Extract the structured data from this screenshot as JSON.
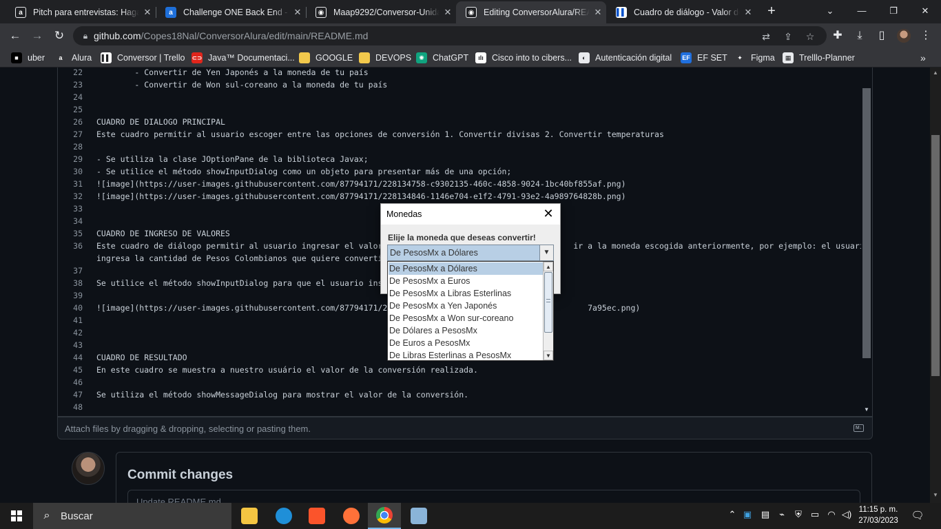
{
  "browser": {
    "tabs": [
      {
        "title": "Pitch para entrevistas: Haga p",
        "favicon": "alura-icon",
        "color": "#202124",
        "letter": "a"
      },
      {
        "title": "Challenge ONE Back End - Ja",
        "favicon": "alura-blue-icon",
        "color": "#1e6fd9",
        "letter": "a"
      },
      {
        "title": "Maap9292/Conversor-Unidad",
        "favicon": "github-icon",
        "color": "#202124",
        "letter": "◉"
      },
      {
        "title": "Editing ConversorAlura/READ",
        "favicon": "github-icon",
        "color": "#202124",
        "letter": "◉"
      },
      {
        "title": "Cuadro de diálogo - Valor de",
        "favicon": "trello-icon",
        "color": "#ffffff",
        "letter": "▌▌"
      }
    ],
    "url_domain": "github.com",
    "url_path": "/Copes18Nal/ConversorAlura/edit/main/README.md",
    "bookmarks": [
      {
        "label": "uber",
        "icon": "uber-icon",
        "color": "#000000",
        "glyph": "■"
      },
      {
        "label": "Alura",
        "icon": "alura-icon",
        "color": "#35363a",
        "glyph": "a"
      },
      {
        "label": "Conversor | Trello",
        "icon": "trello-icon",
        "color": "#ffffff",
        "glyph": "▌▌"
      },
      {
        "label": "Java™ Documentaci...",
        "icon": "oracle-icon",
        "color": "#e0251b",
        "glyph": "⊂⊃"
      },
      {
        "label": "GOOGLE",
        "icon": "folder-icon",
        "color": "#f2c94c",
        "glyph": ""
      },
      {
        "label": "DEVOPS",
        "icon": "folder-icon",
        "color": "#f2c94c",
        "glyph": ""
      },
      {
        "label": "ChatGPT",
        "icon": "chatgpt-icon",
        "color": "#10a37f",
        "glyph": "✺"
      },
      {
        "label": "Cisco into to cibers...",
        "icon": "cisco-icon",
        "color": "#ffffff",
        "glyph": "ılı"
      },
      {
        "label": "Autenticación digital",
        "icon": "globe-icon",
        "color": "#e8eaed",
        "glyph": "◐"
      },
      {
        "label": "EF SET",
        "icon": "efset-icon",
        "color": "#1f6fde",
        "glyph": "EF"
      },
      {
        "label": "Figma",
        "icon": "figma-icon",
        "color": "#35363a",
        "glyph": "✦"
      },
      {
        "label": "Trelllo-Planner",
        "icon": "planner-icon",
        "color": "#e8eaed",
        "glyph": "▦"
      }
    ]
  },
  "editor": {
    "lines": [
      {
        "n": "22",
        "text": "        - Convertir de Yen Japonés a la moneda de tu país"
      },
      {
        "n": "23",
        "text": "        - Convertir de Won sul-coreano a la moneda de tu país"
      },
      {
        "n": "24",
        "text": ""
      },
      {
        "n": "25",
        "text": ""
      },
      {
        "n": "26",
        "text": "CUADRO DE DIALOGO PRINCIPAL"
      },
      {
        "n": "27",
        "text": "Este cuadro permitir al usuario escoger entre las opciones de conversión 1. Convertir divisas 2. Convertir temperaturas"
      },
      {
        "n": "28",
        "text": ""
      },
      {
        "n": "29",
        "text": "- Se utiliza la clase JOptionPane de la biblioteca Javax;"
      },
      {
        "n": "30",
        "text": "- Se utilice el método showInputDialog como un objeto para presentar más de una opción;"
      },
      {
        "n": "31",
        "text": "![image](https://user-images.githubusercontent.com/87794171/228134758-c9302135-460c-4858-9024-1bc40bf855af.png)"
      },
      {
        "n": "32",
        "text": "![image](https://user-images.githubusercontent.com/87794171/228134846-1146e704-e1f2-4791-93e2-4a989764828b.png)"
      },
      {
        "n": "33",
        "text": ""
      },
      {
        "n": "34",
        "text": ""
      },
      {
        "n": "35",
        "text": "CUADRO DE INGRESO DE VALORES"
      },
      {
        "n": "36",
        "text": "Este cuadro de diálogo permitir al usuario ingresar el valor o                                      ir a la moneda escogida anteriormente, por ejemplo: el usuario"
      },
      {
        "n": "",
        "text": "ingresa la cantidad de Pesos Colombianos que quiere convertir d"
      },
      {
        "n": "37",
        "text": ""
      },
      {
        "n": "38",
        "text": "Se utilice el método showInputDialog para que el usuario insert"
      },
      {
        "n": "39",
        "text": ""
      },
      {
        "n": "40",
        "text": "![image](https://user-images.githubusercontent.com/87794171/2281                                       7a95ec.png)"
      },
      {
        "n": "41",
        "text": ""
      },
      {
        "n": "42",
        "text": ""
      },
      {
        "n": "43",
        "text": ""
      },
      {
        "n": "44",
        "text": "CUADRO DE RESULTADO"
      },
      {
        "n": "45",
        "text": "En este cuadro se muestra a nuestro usuário el valor de la conversión realizada."
      },
      {
        "n": "46",
        "text": ""
      },
      {
        "n": "47",
        "text": "Se utiliza el método showMessageDialog para mostrar el valor de la conversión."
      },
      {
        "n": "48",
        "text": ""
      }
    ],
    "attach_hint": "Attach files by dragging & dropping, selecting or pasting them.",
    "markdown_badge": "M↓"
  },
  "commit": {
    "title": "Commit changes",
    "placeholder": "Update README.md"
  },
  "dialog": {
    "title": "Monedas",
    "message": "Elije la moneda que deseas convertir!",
    "selected": "De PesosMx a Dólares",
    "options": [
      "De PesosMx a Dólares",
      "De PesosMx a Euros",
      "De PesosMx a Libras Esterlinas",
      "De PesosMx a Yen Japonés",
      "De PesosMx a Won sur-coreano",
      "De Dólares a PesosMx",
      "De Euros a PesosMx",
      "De Libras Esterlinas a PesosMx"
    ]
  },
  "taskbar": {
    "search_label": "Buscar",
    "apps": [
      {
        "name": "file-explorer-icon",
        "color": "#f4c542"
      },
      {
        "name": "edge-icon",
        "color": "#1f8fd8"
      },
      {
        "name": "brave-icon",
        "color": "#fb542b"
      },
      {
        "name": "firefox-icon",
        "color": "#ff7139"
      },
      {
        "name": "chrome-icon",
        "color": "#4285f4"
      },
      {
        "name": "virtualbox-icon",
        "color": "#8ab4d8"
      }
    ],
    "time": "11:15 p. m.",
    "date": "27/03/2023"
  }
}
